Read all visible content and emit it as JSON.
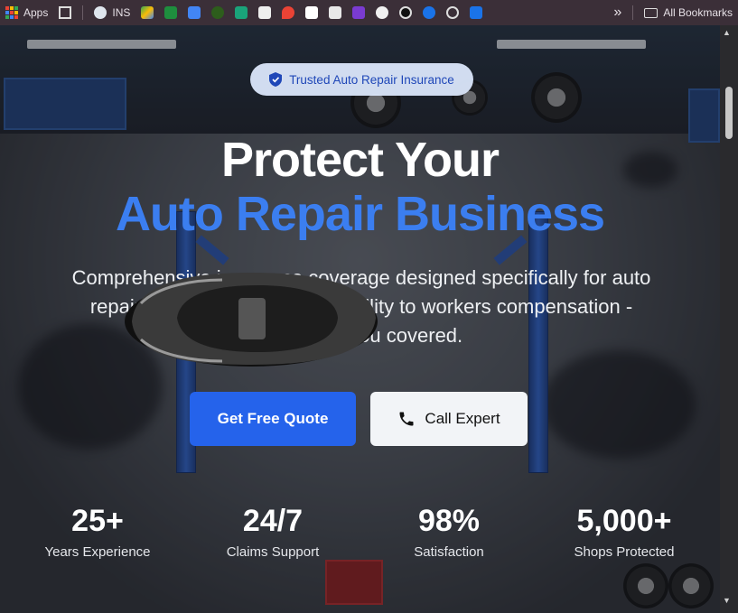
{
  "bookmarks": {
    "apps_label": "Apps",
    "ins_label": "INS",
    "more_glyph": "»",
    "all_bookmarks_label": "All Bookmarks"
  },
  "hero": {
    "badge": "Trusted Auto Repair Insurance",
    "title_line1": "Protect Your",
    "title_line2": "Auto Repair Business",
    "subtitle_line1": "Comprehensive insurance coverage designed specifically for auto",
    "subtitle_line2": "repair shops. From general liability to workers compensation -",
    "subtitle_line3": "we've got you covered.",
    "cta_primary": "Get Free Quote",
    "cta_secondary": "Call Expert"
  },
  "stats": [
    {
      "value": "25+",
      "label": "Years Experience"
    },
    {
      "value": "24/7",
      "label": "Claims Support"
    },
    {
      "value": "98%",
      "label": "Satisfaction"
    },
    {
      "value": "5,000+",
      "label": "Shops Protected"
    }
  ],
  "colors": {
    "accent": "#2563eb",
    "title_blue": "#3b7ef0",
    "badge_text": "#1f47b8"
  },
  "icons": [
    "apps-grid-icon",
    "globe-icon",
    "shield-check-icon",
    "phone-icon",
    "folder-icon"
  ]
}
